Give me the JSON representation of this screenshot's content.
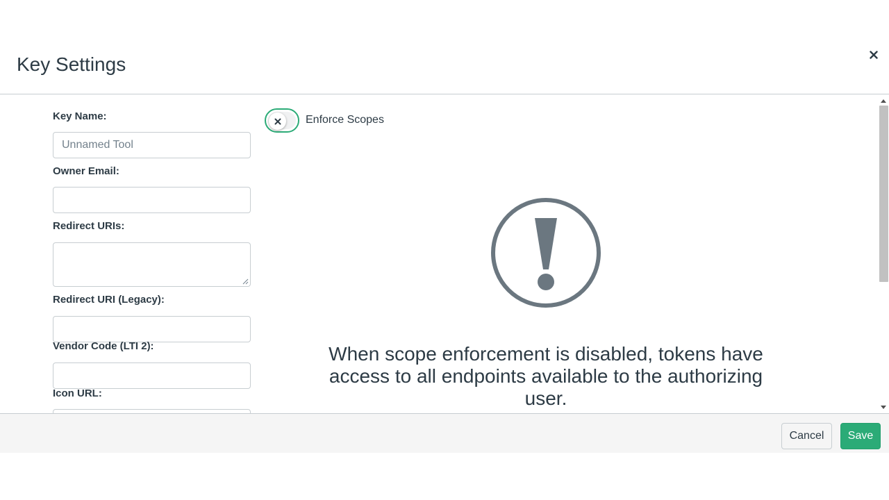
{
  "modal": {
    "title": "Key Settings",
    "close_icon": "close-icon"
  },
  "form": {
    "key_name": {
      "label": "Key Name:",
      "placeholder": "Unnamed Tool",
      "value": ""
    },
    "owner_email": {
      "label": "Owner Email:",
      "value": ""
    },
    "redirect_uris": {
      "label": "Redirect URIs:",
      "value": ""
    },
    "redirect_uri_legacy": {
      "label": "Redirect URI (Legacy):",
      "value": ""
    },
    "vendor_code": {
      "label": "Vendor Code (LTI 2):",
      "value": ""
    },
    "icon_url": {
      "label": "Icon URL:",
      "value": ""
    }
  },
  "scopes": {
    "toggle_label": "Enforce Scopes",
    "enabled": false,
    "warning_icon": "exclamation-circle-icon",
    "warning_message": "When scope enforcement is disabled, tokens have access to all endpoints available to the authorizing user."
  },
  "footer": {
    "cancel_label": "Cancel",
    "save_label": "Save"
  },
  "colors": {
    "accent": "#2bab77",
    "text": "#2d3b45",
    "icon": "#6b7780",
    "border": "#c7cdd1",
    "footer_bg": "#f5f5f5"
  }
}
